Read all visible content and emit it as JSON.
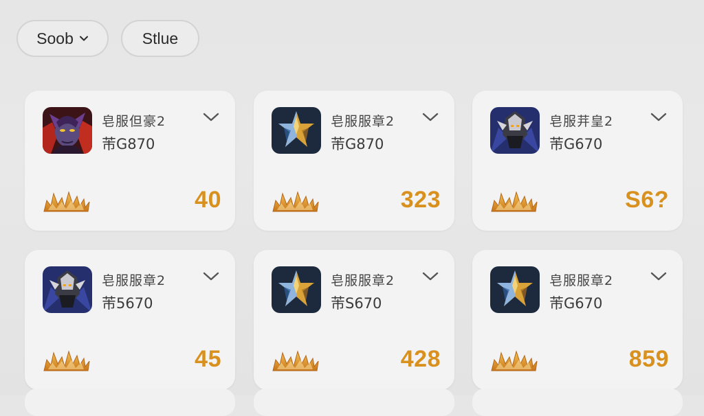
{
  "filters": {
    "first": "Soob",
    "second": "Stlue"
  },
  "cards": [
    {
      "title": "皂服但豪2",
      "code": "芾G870",
      "score": "40",
      "avatar": "purple-warrior-icon"
    },
    {
      "title": "皂服服章2",
      "code": "芾G870",
      "score": "323",
      "avatar": "gold-blue-crest-icon"
    },
    {
      "title": "皂服茾皇2",
      "code": "芾G670",
      "score": "S6?",
      "avatar": "armored-knight-icon"
    },
    {
      "title": "皂服服章2",
      "code": "芾5670",
      "score": "45",
      "avatar": "armored-knight-icon"
    },
    {
      "title": "皂服服章2",
      "code": "芾S670",
      "score": "428",
      "avatar": "gold-blue-crest-icon"
    },
    {
      "title": "皂服服章2",
      "code": "芾G670",
      "score": "859",
      "avatar": "gold-blue-crest-icon"
    }
  ],
  "colors": {
    "score": "#d8901f",
    "card_bg": "#f3f3f3",
    "page_bg": "#e6e6e6"
  }
}
